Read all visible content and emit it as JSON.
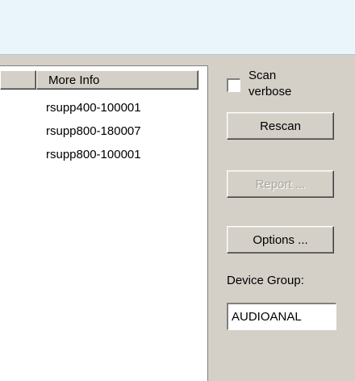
{
  "list": {
    "columns": [
      "",
      "More Info"
    ],
    "rows": [
      {
        "more_info": "rsupp400-100001"
      },
      {
        "more_info": "rsupp800-180007"
      },
      {
        "more_info": "rsupp800-100001"
      }
    ]
  },
  "controls": {
    "scan_verbose_label": "Scan verbose",
    "scan_verbose_checked": false,
    "rescan_label": "Rescan",
    "report_label": "Report ...",
    "options_label": "Options ...",
    "device_group_label": "Device Group:",
    "device_group_value": "AUDIOANAL"
  }
}
